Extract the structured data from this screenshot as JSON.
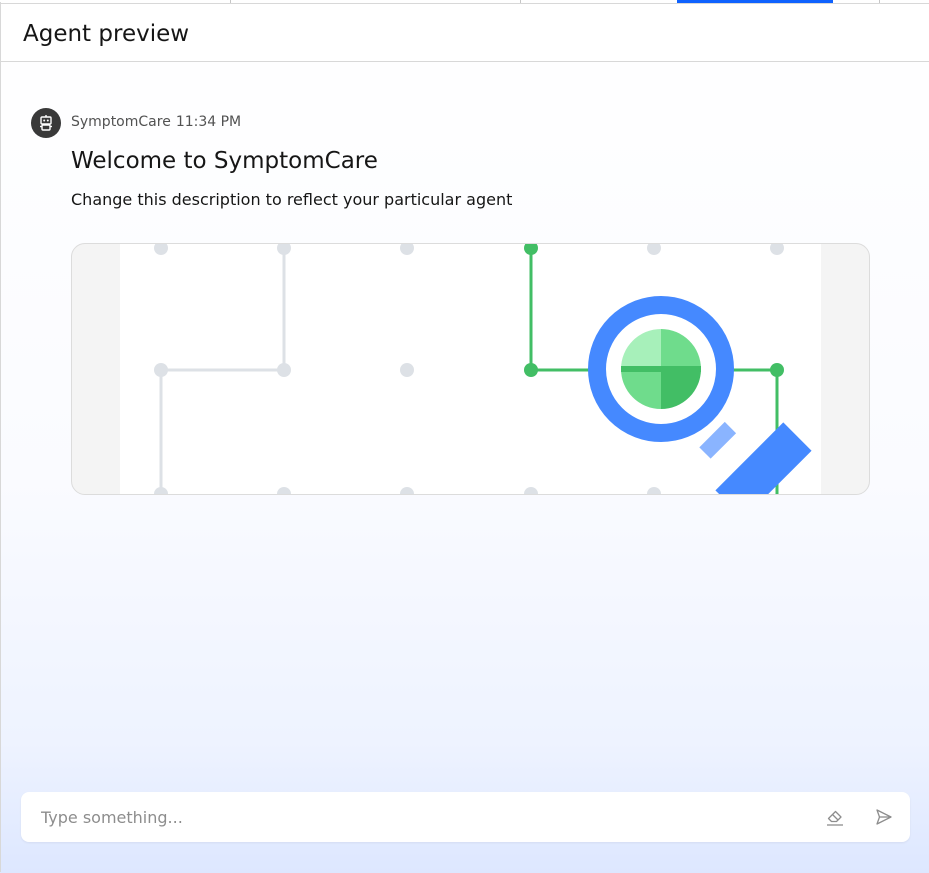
{
  "panel": {
    "title": "Agent preview"
  },
  "message": {
    "avatar_icon": "robot-icon",
    "sender": "SymptomCare",
    "time": "11:34 PM",
    "title": "Welcome to SymptomCare",
    "description": "Change this description to reflect your particular agent",
    "image_icon": "magnifier-network-illustration"
  },
  "composer": {
    "placeholder": "Type something...",
    "value": "",
    "clear_icon": "eraser-icon",
    "send_icon": "send-icon"
  },
  "colors": {
    "accent": "#0f62fe",
    "avatar_bg": "#393939",
    "network_green": "#42be65",
    "network_gray": "#dde1e6",
    "magnifier_blue": "#4589ff"
  }
}
